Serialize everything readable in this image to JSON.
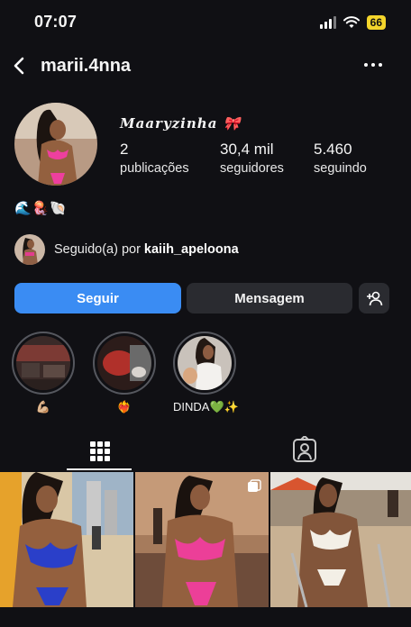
{
  "status_bar": {
    "time": "07:07",
    "battery": "66",
    "icons": [
      "signal-icon",
      "wifi-icon",
      "battery-icon"
    ]
  },
  "header": {
    "username": "marii.4nna",
    "icons": [
      "back-arrow-icon",
      "more-options-icon"
    ]
  },
  "profile": {
    "display_name": "𝑴𝒂𝒂𝒓𝒚𝒛𝒊𝒏𝒉𝒂 🎀",
    "stats": [
      {
        "value": "2",
        "label": "publicações"
      },
      {
        "value": "30,4 mil",
        "label": "seguidores"
      },
      {
        "value": "5.460",
        "label": "seguindo"
      }
    ],
    "bio": "🌊🪼🐚",
    "followed_by_prefix": "Seguido(a) por",
    "followed_by_user": "kaiih_apeloona"
  },
  "actions": {
    "follow": "Seguir",
    "message": "Mensagem",
    "suggest_icon": "add-person-icon"
  },
  "highlights": [
    {
      "label": "💪🏼"
    },
    {
      "label": "❤️‍🔥"
    },
    {
      "label": "DINDA💚✨"
    }
  ],
  "tabs": [
    {
      "icon": "grid-icon",
      "selected": true
    },
    {
      "icon": "tagged-person-icon",
      "selected": false
    }
  ],
  "colors": {
    "background": "#101014",
    "accent_blue": "#3a8cf3",
    "secondary_button": "#2a2b30",
    "battery_yellow": "#f4d52b"
  }
}
